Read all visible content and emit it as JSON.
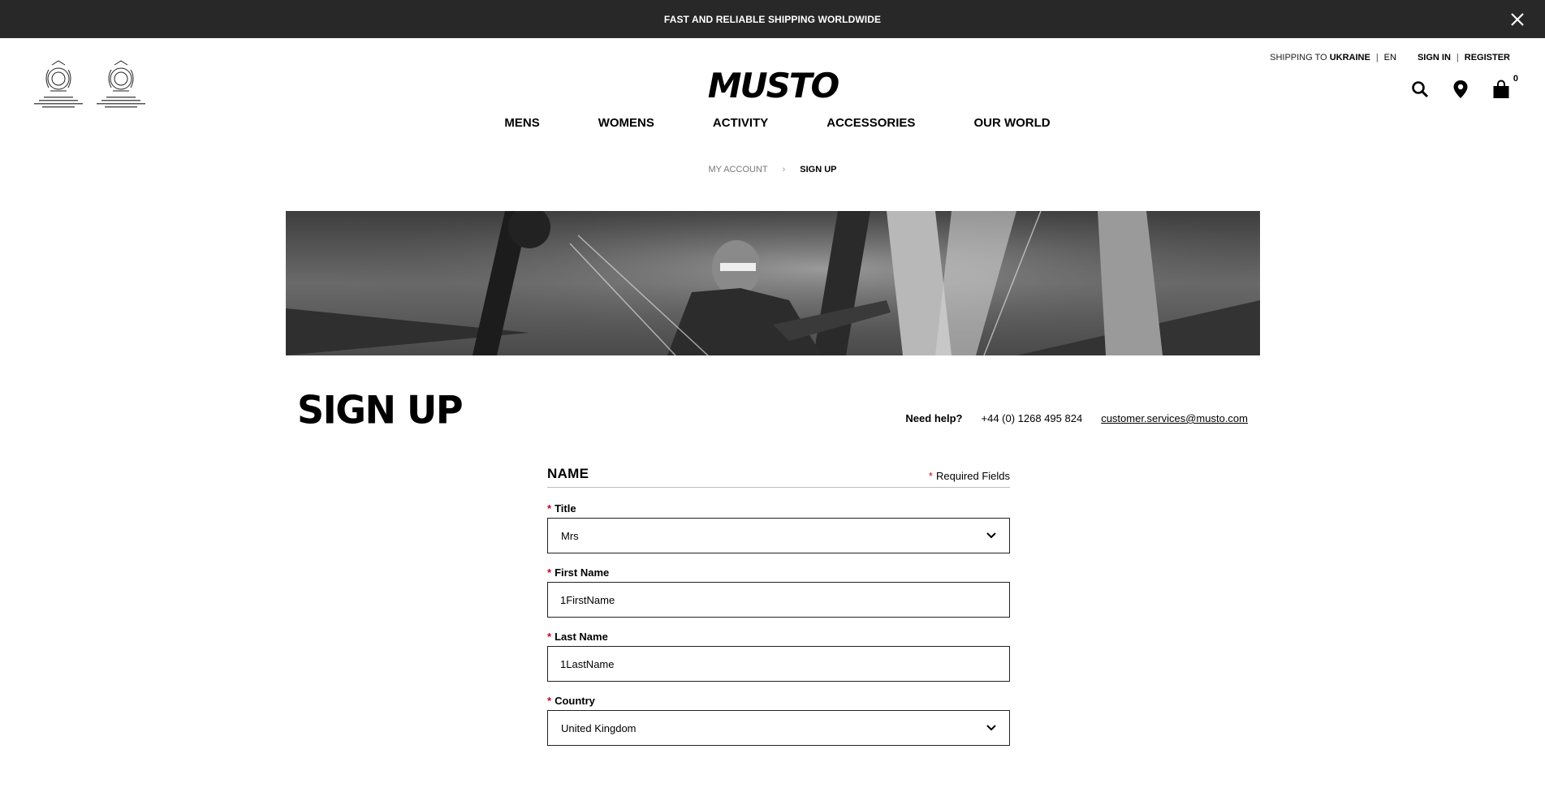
{
  "promo": {
    "text": "FAST AND RELIABLE SHIPPING WORLDWIDE"
  },
  "header": {
    "logo_text": "MUSTO",
    "shipping_prefix": "SHIPPING TO",
    "shipping_country": "UKRAINE",
    "language": "EN",
    "sign_in": "SIGN IN",
    "register": "REGISTER",
    "cart_count": "0",
    "icons": [
      "search-icon",
      "store-locator-icon",
      "bag-icon"
    ]
  },
  "nav": {
    "items": [
      "MENS",
      "WOMENS",
      "ACTIVITY",
      "ACCESSORIES",
      "OUR WORLD"
    ]
  },
  "breadcrumb": {
    "parent": "MY ACCOUNT",
    "separator": "›",
    "current": "SIGN UP"
  },
  "page": {
    "title": "SIGN UP",
    "help_label": "Need help?",
    "help_phone": "+44 (0) 1268 495 824",
    "help_email": "customer.services@musto.com"
  },
  "form": {
    "section_title": "NAME",
    "required_note": "Required Fields",
    "required_mark": "*",
    "title_label": "Title",
    "title_value": "Mrs",
    "first_name_label": "First Name",
    "first_name_value": "1FirstName",
    "last_name_label": "Last Name",
    "last_name_value": "1LastName",
    "country_label": "Country",
    "country_value": "United Kingdom"
  },
  "colors": {
    "promo_bg": "#282828",
    "required_star": "#d0021b",
    "border": "#222222"
  }
}
